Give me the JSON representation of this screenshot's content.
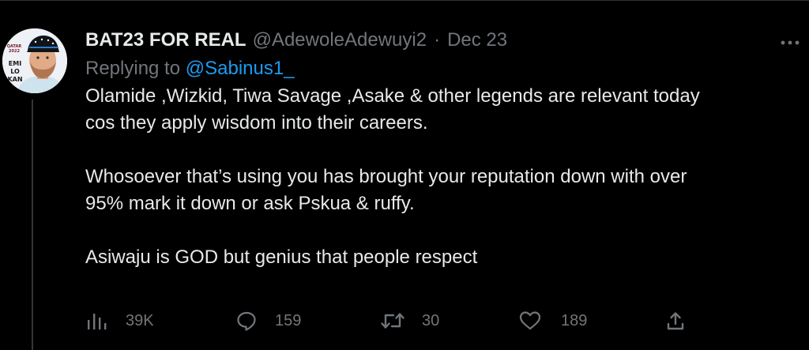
{
  "tweet": {
    "display_name": "BAT23 FOR REAL",
    "handle": "@AdewoleAdewuyi2",
    "separator": "·",
    "date": "Dec 23",
    "replying_prefix": "Replying to",
    "replying_to": "@Sabinus1_",
    "paragraphs": [
      "Olamide ,Wizkid, Tiwa Savage ,Asake & other legends are relevant today",
      "cos they apply wisdom into their careers.",
      "Whosoever that’s using you has brought your reputation down with over",
      "95% mark it down or ask Pskua & ruffy.",
      "Asiwaju is GOD but genius that people respect"
    ],
    "avatar_text": [
      "EMI",
      "LO KAN"
    ],
    "avatar_badge": "QATAR 2022"
  },
  "actions": {
    "views": "39K",
    "replies": "159",
    "retweets": "30",
    "likes": "189"
  },
  "icons": {
    "views": "views-icon",
    "reply": "reply-icon",
    "retweet": "retweet-icon",
    "like": "like-icon",
    "share": "share-icon",
    "more": "more-icon"
  },
  "colors": {
    "background": "#000000",
    "text": "#e7e9ea",
    "muted": "#71767b",
    "link": "#1d9bf0"
  }
}
